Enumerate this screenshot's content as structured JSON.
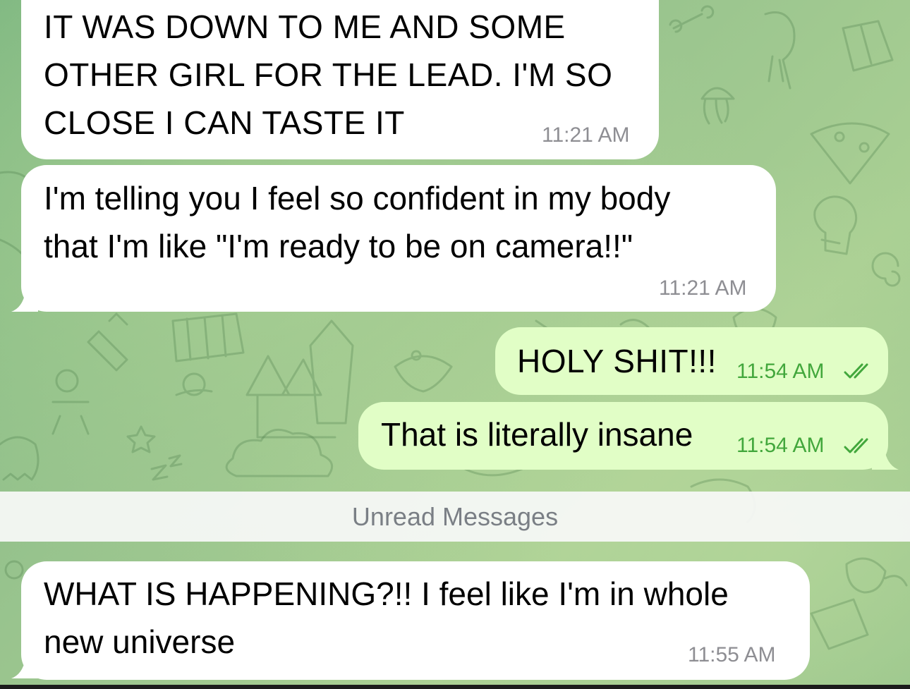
{
  "chat": {
    "unread_divider": "Unread Messages",
    "messages": [
      {
        "direction": "incoming",
        "text": "IT WAS DOWN TO ME AND SOME\nOTHER GIRL FOR THE LEAD. I'M SO\nCLOSE I CAN TASTE IT",
        "time": "11:21 AM"
      },
      {
        "direction": "incoming",
        "text": "I'm telling you I feel so confident in my body\nthat I'm like \"I'm ready to be on camera!!\"",
        "time": "11:21 AM"
      },
      {
        "direction": "outgoing",
        "text": "HOLY SHIT!!!",
        "time": "11:54 AM",
        "status": "read",
        "status_icon": "double-check-icon"
      },
      {
        "direction": "outgoing",
        "text": "That is literally insane",
        "time": "11:54 AM",
        "status": "read",
        "status_icon": "double-check-icon"
      },
      {
        "direction": "incoming",
        "text": "WHAT IS HAPPENING?!! I feel like I'm in whole\nnew universe",
        "time": "11:55 AM"
      }
    ]
  },
  "colors": {
    "incoming_bubble": "#ffffff",
    "outgoing_bubble": "#e1fec6",
    "outgoing_time": "#42a73c",
    "incoming_time": "#8e8e93",
    "chat_background": "#9cc48f"
  }
}
